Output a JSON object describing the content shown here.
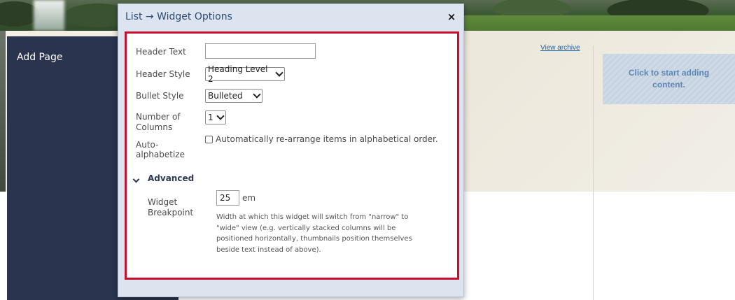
{
  "page": {
    "sidebar_title": "Add Page",
    "view_archive": "View archive",
    "add_content": "Click to start adding content."
  },
  "modal": {
    "title": "List → Widget Options",
    "close_symbol": "×",
    "fields": {
      "header_text": {
        "label": "Header Text",
        "value": ""
      },
      "header_style": {
        "label": "Header Style",
        "value": "Heading Level 2"
      },
      "bullet_style": {
        "label": "Bullet Style",
        "value": "Bulleted"
      },
      "columns": {
        "label_line1": "Number of",
        "label_line2": "Columns",
        "value": "1"
      },
      "auto_alpha": {
        "label_line1": "Auto-",
        "label_line2": "alphabetize",
        "checkbox_label": "Automatically re-arrange items in alphabetical order.",
        "checked": false
      }
    },
    "advanced": {
      "label": "Advanced",
      "breakpoint": {
        "label_line1": "Widget",
        "label_line2": "Breakpoint",
        "value": "25",
        "unit": "em",
        "help_lines": [
          "Width at which this widget will switch from \"narrow\" to",
          "\"wide\" view (e.g. vertically stacked columns will be",
          "positioned horizontally, thumbnails position themselves",
          "beside text instead of above)."
        ]
      }
    }
  },
  "colors": {
    "modal_border_accent": "#c8102e",
    "sidebar_bg": "#2b344e",
    "modal_bg": "#dbe4ef",
    "link": "#2266aa"
  }
}
